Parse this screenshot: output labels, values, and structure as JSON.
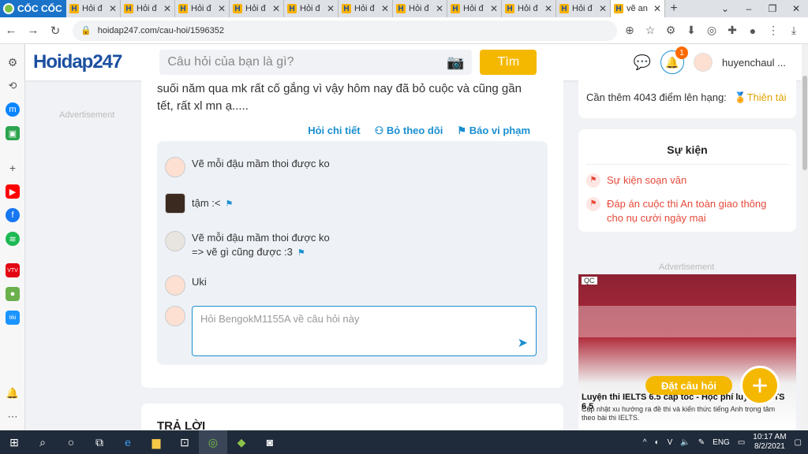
{
  "browser": {
    "brand": "CỐC CỐC",
    "tabs": [
      {
        "title": "Hỏi đ"
      },
      {
        "title": "Hỏi đ"
      },
      {
        "title": "Hỏi đ"
      },
      {
        "title": "Hỏi đ"
      },
      {
        "title": "Hỏi đ"
      },
      {
        "title": "Hỏi đ"
      },
      {
        "title": "Hỏi đ"
      },
      {
        "title": "Hỏi đ"
      },
      {
        "title": "Hỏi đ"
      },
      {
        "title": "Hỏi đ"
      },
      {
        "title": "vẽ an"
      }
    ],
    "url": "hoidap247.com/cau-hoi/1596352"
  },
  "header": {
    "logo": "Hoidap247",
    "search_placeholder": "Câu hỏi của bạn là gì?",
    "search_button": "Tìm",
    "notif_count": "1",
    "username": "huyenchaul ..."
  },
  "left_ad": "Advertisement",
  "question": {
    "text": "suối năm qua mk rất cố gắng vì vậy hôm nay đã bỏ cuộc và cũng gần tết, rất xl mn ạ.....",
    "actions": {
      "detail": "Hỏi chi tiết",
      "unfollow": "Bỏ theo dõi",
      "report": "Báo vi phạm"
    }
  },
  "comments": [
    {
      "text": "Vẽ mỗi đậu mầm thoi được ko"
    },
    {
      "text": "tậm :<"
    },
    {
      "text": "Vẽ mỗi đậu mầm thoi được ko",
      "text2": "=> vẽ gì cũng được :3"
    },
    {
      "text": "Uki"
    }
  ],
  "reply_placeholder": "Hỏi BengokM1155A về câu hỏi này",
  "answer_title": "TRẢ LỜI",
  "sidebar": {
    "rank_text": "Cần thêm 4043 điểm lên hạng:",
    "rank_name": "Thiên tài",
    "events_title": "Sự kiện",
    "events": [
      "Sự kiện soạn văn",
      "Đáp án cuộc thi An toàn giao thông cho nụ cười ngày mai"
    ],
    "ad_label": "Advertisement",
    "ad_qc": "QC",
    "ad_title": "Luyện thi IELTS 6.5 cấp tốc - Học phí luyện IELTS 6.5",
    "ad_desc": "Cập nhật xu hướng ra đề thi và kiến thức tiếng Anh trọng tâm theo bài thi IELTS."
  },
  "ask_button": "Đặt câu hỏi",
  "taskbar": {
    "lang": "ENG",
    "time": "10:17 AM",
    "date": "8/2/2021"
  },
  "colors": {
    "brand_blue": "#1b8fd1",
    "accent_yellow": "#f5b800",
    "event_red": "#e64a3b"
  }
}
